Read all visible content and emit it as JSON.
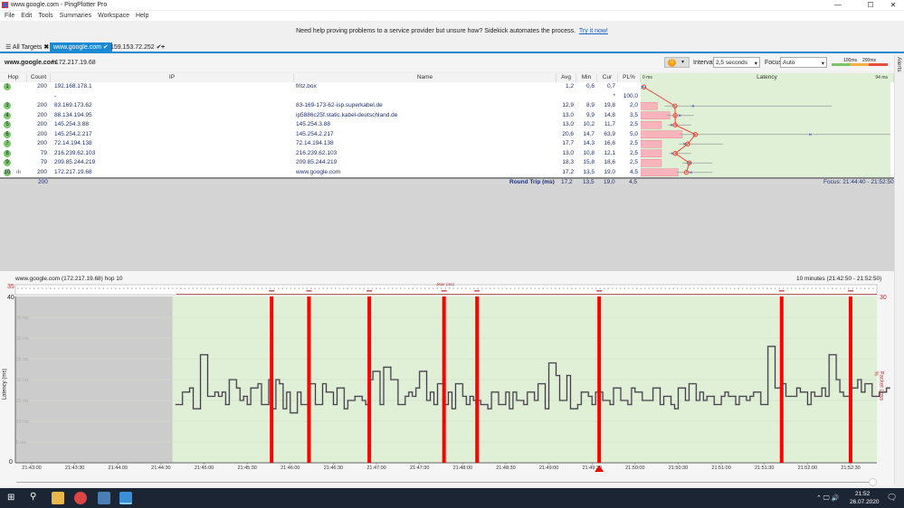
{
  "window": {
    "title": "www.google.com - PingPlotter Pro",
    "controls": [
      "—",
      "☐",
      "✕"
    ]
  },
  "menu": [
    "File",
    "Edit",
    "Tools",
    "Summaries",
    "Workspace",
    "Help"
  ],
  "banner": {
    "text": "Need help proving problems to a service provider but unsure how? Sidekick automates the process.",
    "link": "Try it now!"
  },
  "tabs": [
    {
      "label": "All Targets",
      "icon": "list-icon",
      "close": "✖"
    },
    {
      "label": "www.google.com",
      "active": true,
      "check": "✔"
    },
    {
      "label": "159.153.72.252",
      "check": "✔"
    }
  ],
  "tab_add": "+",
  "toolbar": {
    "target_name": "www.google.com",
    "target_ip": " / 172.217.19.68",
    "interval_label": "Interval",
    "interval_value": "2,5 seconds",
    "focus_label": "Focus",
    "focus_value": "Auto",
    "scale_100": "100ms",
    "scale_200": "200ms",
    "pause_icon": "pause-icon"
  },
  "alerts_label": "Alerts",
  "table": {
    "headers": {
      "hop": "Hop",
      "count": "Count",
      "ip": "IP",
      "name": "Name",
      "avg": "Avg",
      "min": "Min",
      "cur": "Cur",
      "pl": "PL%",
      "latency": "Latency",
      "lat_min": "0 ms",
      "lat_max": "94 ms"
    },
    "rows": [
      {
        "hop": "1",
        "count": "200",
        "ip": "192.168.178.1",
        "name": "fritz.box",
        "avg": "1,2",
        "min": "0,6",
        "cur": "0,7",
        "pl": "",
        "whisker_max": 2
      },
      {
        "hop": "",
        "count": "",
        "ip": "-",
        "name": "",
        "avg": "",
        "min": "",
        "cur": "*",
        "pl": "100,0"
      },
      {
        "hop": "3",
        "count": "200",
        "ip": "83.169.173.62",
        "name": "83-169-173-62-isp.superkabel.de",
        "avg": "12,9",
        "min": "8,9",
        "cur": "19,8",
        "pl": "2,0",
        "whisker_max": 72
      },
      {
        "hop": "4",
        "count": "200",
        "ip": "88.134.194.95",
        "name": "ip5886c25f.static.kabel-deutschland.de",
        "avg": "13,0",
        "min": "9,9",
        "cur": "14,8",
        "pl": "3,5",
        "whisker_max": 20
      },
      {
        "hop": "5",
        "count": "200",
        "ip": "145.254.3.88",
        "name": "145.254.3.88",
        "avg": "13,0",
        "min": "10,2",
        "cur": "11,7",
        "pl": "2,5",
        "whisker_max": 19
      },
      {
        "hop": "6",
        "count": "200",
        "ip": "145.254.2.217",
        "name": "145.254.2.217",
        "avg": "20,6",
        "min": "14,7",
        "cur": "63,9",
        "pl": "5,0",
        "whisker_max": 94
      },
      {
        "hop": "7",
        "count": "200",
        "ip": "72.14.194.138",
        "name": "72.14.194.138",
        "avg": "17,7",
        "min": "14,3",
        "cur": "16,6",
        "pl": "2,5",
        "whisker_max": 31
      },
      {
        "hop": "8",
        "count": "79",
        "ip": "216.239.62.103",
        "name": "216.239.62.103",
        "avg": "13,0",
        "min": "10,8",
        "cur": "12,1",
        "pl": "2,5",
        "whisker_max": 19
      },
      {
        "hop": "9",
        "count": "79",
        "ip": "209.85.244.219",
        "name": "209.85.244.219",
        "avg": "18,3",
        "min": "15,8",
        "cur": "18,6",
        "pl": "2,5",
        "whisker_max": 27
      },
      {
        "hop": "10",
        "count": "200",
        "ip": "172.217.19.68",
        "name": "www.google.com",
        "avg": "17,2",
        "min": "13,5",
        "cur": "19,0",
        "pl": "4,5",
        "whisker_max": 27,
        "graph_icon": "bar-chart-icon"
      }
    ],
    "summary": {
      "count": "200",
      "label": "Round Trip (ms)",
      "avg": "17,2",
      "min": "13,5",
      "cur": "19,0",
      "pl": "4,5",
      "focus": "Focus: 21:44:40 - 21:52:50"
    }
  },
  "chart_data": {
    "type": "line",
    "title": "www.google.com (172.217.19.68) hop 10",
    "range_label": "10 minutes (21:42:50 - 21:52:50)",
    "jitter_label": "Jitter (ms)",
    "jitter_axis": "35",
    "ylabel": "Latency (ms)",
    "y2label": "Packet Loss %",
    "y2_max": "30",
    "ylim": [
      0,
      40
    ],
    "y_top": "40",
    "y_bottom": "0",
    "ygrid": [
      "5 ms",
      "10 ms",
      "15 ms",
      "20 ms",
      "25 ms",
      "30 ms",
      "35 ms"
    ],
    "xticks": [
      "21:43:00",
      "21:43:30",
      "21:44:00",
      "21:44:30",
      "21:45:00",
      "21:45:30",
      "21:46:00",
      "21:46:30",
      "21:47:00",
      "21:47:30",
      "21:48:00",
      "21:48:30",
      "21:49:00",
      "21:49:30",
      "21:50:00",
      "21:50:30",
      "21:51:00",
      "21:51:30",
      "21:52:00",
      "21:52:30"
    ],
    "x_start": "21:44:40",
    "interval_s": 2.5,
    "no_data_until": "21:44:38",
    "packet_loss_times": [
      "21:45:47",
      "21:46:13",
      "21:46:55",
      "21:47:47",
      "21:48:10",
      "21:49:35",
      "21:51:42",
      "21:52:30"
    ],
    "marker_time": "21:49:35",
    "colors": {
      "series": "#222222",
      "loss": "#ff0000",
      "background": "#dff0d6",
      "nodata": "#cccccc"
    },
    "values": [
      14,
      14,
      17,
      17,
      18,
      13,
      13,
      26,
      26,
      16,
      16,
      17,
      16,
      17,
      14,
      20,
      20,
      18,
      15,
      16,
      14,
      18,
      18,
      19,
      14,
      14,
      20,
      13,
      20,
      19,
      13,
      17,
      12,
      12,
      17,
      14,
      14,
      19,
      19,
      14,
      14,
      19,
      17,
      17,
      14,
      18,
      18,
      13,
      15,
      15,
      16,
      16,
      15,
      14,
      20,
      22,
      22,
      14,
      23,
      23,
      20,
      20,
      14,
      14,
      16,
      17,
      16,
      18,
      22,
      22,
      15,
      17,
      14,
      19,
      19,
      14,
      17,
      13,
      19,
      19,
      16,
      14,
      16,
      15,
      15,
      14,
      14,
      13,
      17,
      17,
      14,
      14,
      17,
      13,
      17,
      15,
      15,
      14,
      17,
      17,
      15,
      19,
      19,
      13,
      24,
      24,
      21,
      15,
      15,
      21,
      13,
      13,
      14,
      17,
      17,
      16,
      14,
      17,
      17,
      15,
      15,
      14,
      18,
      18,
      15,
      15,
      14,
      18,
      17,
      17,
      15,
      15,
      15,
      18,
      18,
      14,
      16,
      16,
      14,
      13,
      18,
      18,
      15,
      19,
      19,
      15,
      17,
      15,
      16,
      16,
      14,
      14,
      16,
      17,
      16,
      16,
      14,
      16,
      16,
      15,
      16,
      17,
      17,
      14,
      14,
      28,
      28,
      18,
      18,
      19,
      16,
      16,
      16,
      18,
      17,
      17,
      14,
      17,
      16,
      16,
      18,
      16,
      26,
      26,
      20,
      17,
      16,
      16,
      18,
      18,
      20,
      17,
      19,
      19,
      16,
      16,
      17,
      17,
      18
    ]
  },
  "taskbar": {
    "time": "21:52",
    "date": "26.07.2020"
  }
}
